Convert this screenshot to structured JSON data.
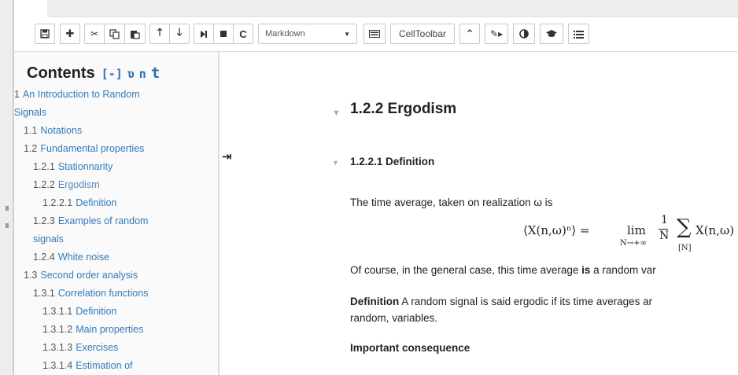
{
  "toolbar": {
    "cell_type": "Markdown",
    "celltoolbar_label": "CellToolbar"
  },
  "toc": {
    "title": "Contents",
    "collapse_ctl": "[-]",
    "ctl_a": "ʋ",
    "ctl_n": "n",
    "ctl_t": "t",
    "items": [
      {
        "num": "1",
        "text": "An Introduction to Random"
      },
      {
        "num": "",
        "text": "Signals"
      },
      {
        "num": "1.1",
        "text": "Notations"
      },
      {
        "num": "1.2",
        "text": "Fundamental properties"
      },
      {
        "num": "1.2.1",
        "text": "Stationnarity"
      },
      {
        "num": "1.2.2",
        "text": "Ergodism"
      },
      {
        "num": "1.2.2.1",
        "text": "Definition"
      },
      {
        "num": "1.2.3",
        "text": "Examples of random"
      },
      {
        "num": "",
        "text": "signals"
      },
      {
        "num": "1.2.4",
        "text": "White noise"
      },
      {
        "num": "1.3",
        "text": "Second order analysis"
      },
      {
        "num": "1.3.1",
        "text": "Correlation functions"
      },
      {
        "num": "1.3.1.1",
        "text": "Definition"
      },
      {
        "num": "1.3.1.2",
        "text": "Main properties"
      },
      {
        "num": "1.3.1.3",
        "text": "Exercises"
      },
      {
        "num": "1.3.1.4",
        "text": "Estimation of"
      }
    ]
  },
  "notebook": {
    "section_title": "1.2.2  Ergodism",
    "subsection_title": "1.2.2.1  Definition",
    "para1": "The time average, taken on realization ω is",
    "equation": {
      "lhs": "⟨X(n,ω)ⁿ⟩ =",
      "lim": "lim",
      "lim_sub": "N→+∞",
      "frac_num": "1",
      "frac_den": "N",
      "sum": "∑",
      "sum_sub": "[N]",
      "rhs": "X(n,ω)"
    },
    "para2_a": "Of course, in the general case, this time average ",
    "para2_bold": "is",
    "para2_b": " a random var",
    "para3_bold": "Definition",
    "para3_a": " A random signal is said ergodic if its time averages ar",
    "para3_b": "random, variables.",
    "para4_bold": "Important consequence"
  }
}
